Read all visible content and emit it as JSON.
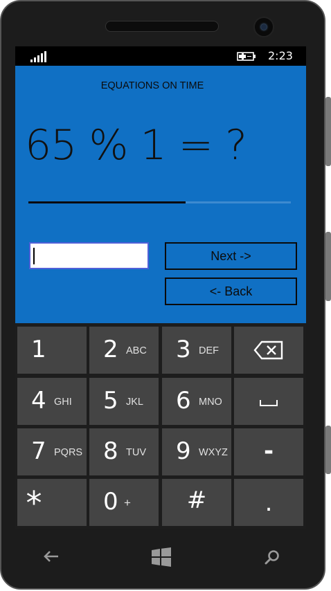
{
  "status": {
    "time": "2:23"
  },
  "app": {
    "title": "EQUATIONS ON TIME",
    "question": "65 % 1 = ?",
    "progress": 0.6,
    "answer_value": "",
    "next_label": "Next ->",
    "back_label": "<- Back"
  },
  "keypad": {
    "keys": [
      {
        "main": "1",
        "sub": ""
      },
      {
        "main": "2",
        "sub": "ABC"
      },
      {
        "main": "3",
        "sub": "DEF"
      },
      {
        "main": "backspace-icon",
        "sub": ""
      },
      {
        "main": "4",
        "sub": "GHI"
      },
      {
        "main": "5",
        "sub": "JKL"
      },
      {
        "main": "6",
        "sub": "MNO"
      },
      {
        "main": "space-icon",
        "sub": ""
      },
      {
        "main": "7",
        "sub": "PQRS"
      },
      {
        "main": "8",
        "sub": "TUV"
      },
      {
        "main": "9",
        "sub": "WXYZ"
      },
      {
        "main": "-",
        "sub": ""
      },
      {
        "main": "*",
        "sub": ""
      },
      {
        "main": "0",
        "sub": "+"
      },
      {
        "main": "#",
        "sub": ""
      },
      {
        "main": ".",
        "sub": ""
      }
    ]
  },
  "nav": {
    "icons": [
      "back-arrow-icon",
      "windows-icon",
      "search-icon"
    ]
  },
  "colors": {
    "accent": "#1070c4",
    "key_bg": "#444444",
    "keypad_bg": "#1d1d1d"
  }
}
